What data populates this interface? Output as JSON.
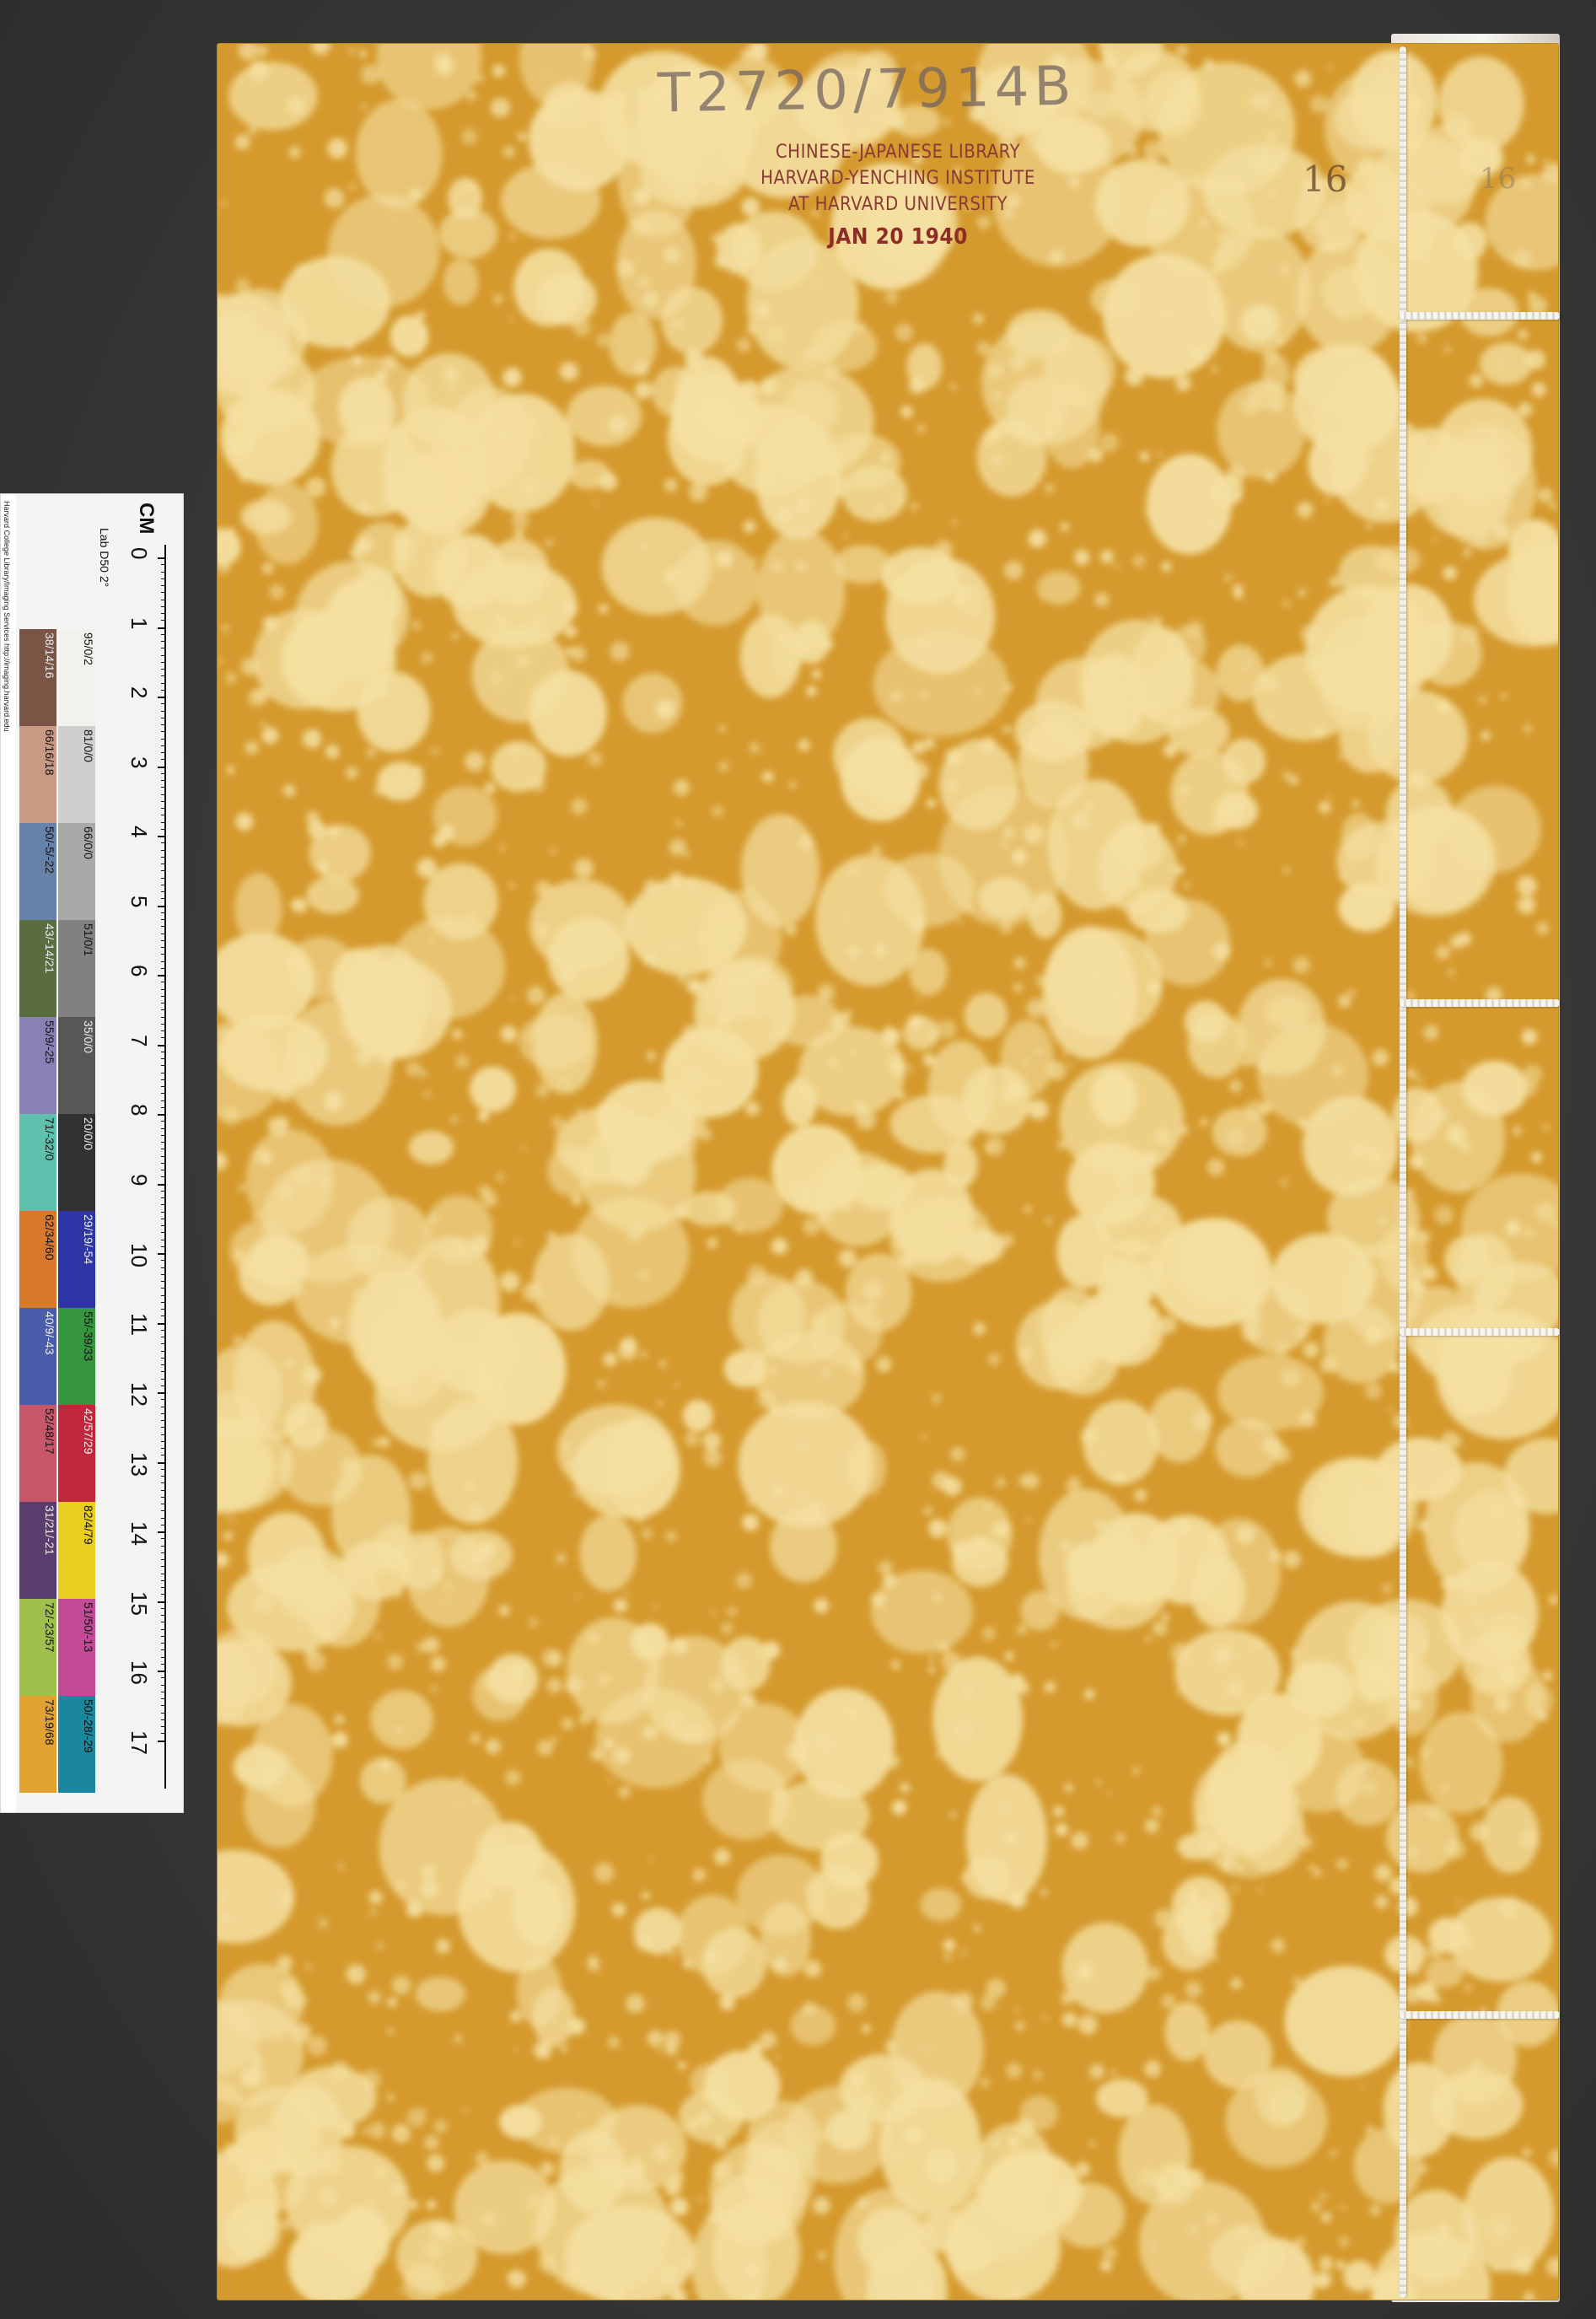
{
  "handwritten_call_number": "T2720/7914B",
  "stamp": {
    "line1": "CHINESE-JAPANESE LIBRARY",
    "line2": "HARVARD-YENCHING INSTITUTE",
    "line3": "AT HARVARD UNIVERSITY",
    "date": "JAN 20 1940"
  },
  "volume_number": "16",
  "volume_number_faint": "16",
  "colors": {
    "cover_base": "#d59a2e",
    "cover_spot": "#f4e0a2",
    "thread": "#f3f1ea",
    "stamp_ink": "#8a3b35"
  },
  "target": {
    "credit": "Harvard College Library/Imaging Services http://imaging.harvard.edu",
    "unit_label": "CM",
    "lab_label": "Lab D50 2°",
    "scale_numbers": [
      "0",
      "1",
      "2",
      "3",
      "4",
      "5",
      "6",
      "7",
      "8",
      "9",
      "10",
      "11",
      "12",
      "13",
      "14",
      "15",
      "16",
      "17"
    ],
    "gray_patches": [
      {
        "label": "95/0/2",
        "color": "#f2f1ee"
      },
      {
        "label": "81/0/0",
        "color": "#cfcfcf"
      },
      {
        "label": "66/0/0",
        "color": "#a9a9a9"
      },
      {
        "label": "51/0/1",
        "color": "#818181"
      },
      {
        "label": "35/0/0",
        "color": "#585858"
      },
      {
        "label": "20/0/0",
        "color": "#313131"
      },
      {
        "label": "29/19/-54",
        "color": "#2f35a4"
      },
      {
        "label": "55/-39/33",
        "color": "#36953f"
      },
      {
        "label": "42/57/29",
        "color": "#c0273a"
      },
      {
        "label": "82/4/79",
        "color": "#e9cd1f"
      },
      {
        "label": "51/50/-13",
        "color": "#c34a97"
      },
      {
        "label": "50/-28/-29",
        "color": "#1a879f"
      }
    ],
    "color_patches": [
      {
        "label": "38/14/16",
        "color": "#7a5444"
      },
      {
        "label": "66/16/18",
        "color": "#c89a83"
      },
      {
        "label": "50/-5/-22",
        "color": "#6782a9"
      },
      {
        "label": "43/-14/21",
        "color": "#5a6d3f"
      },
      {
        "label": "55/9/-25",
        "color": "#8a80b6"
      },
      {
        "label": "71/-32/0",
        "color": "#5dc1ae"
      },
      {
        "label": "62/34/60",
        "color": "#d8792a"
      },
      {
        "label": "40/9/-43",
        "color": "#4b5caa"
      },
      {
        "label": "52/48/17",
        "color": "#c8576a"
      },
      {
        "label": "31/21/-21",
        "color": "#5b3d6d"
      },
      {
        "label": "72/-23/57",
        "color": "#9fc04c"
      },
      {
        "label": "73/19/68",
        "color": "#e2a232"
      }
    ]
  }
}
